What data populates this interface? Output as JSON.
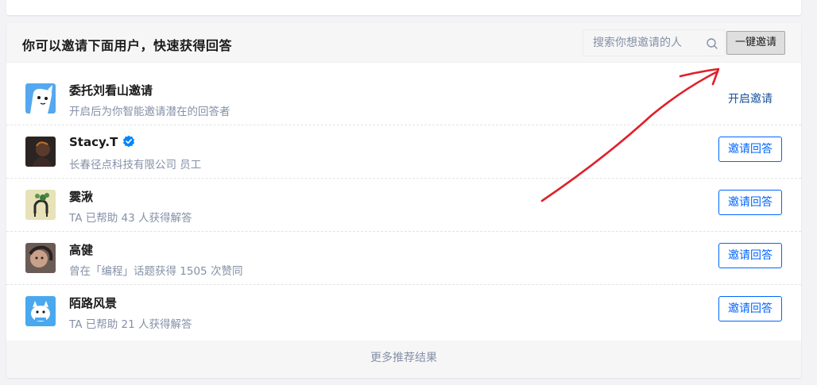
{
  "header": {
    "title": "你可以邀请下面用户，快速获得回答",
    "search_placeholder": "搜索你想邀请的人",
    "invite_all_label": "一键邀请"
  },
  "delegate": {
    "name": "委托刘看山邀请",
    "desc": "开启后为你智能邀请潜在的回答者",
    "action_label": "开启邀请"
  },
  "users": [
    {
      "name": "Stacy.T",
      "desc": "长春径点科技有限公司 员工",
      "verified": true,
      "action_label": "邀请回答"
    },
    {
      "name": "霙湫",
      "desc": "TA 已帮助 43 人获得解答",
      "verified": false,
      "action_label": "邀请回答"
    },
    {
      "name": "高健",
      "desc": "曾在「编程」话题获得 1505 次赞同",
      "verified": false,
      "action_label": "邀请回答"
    },
    {
      "name": "陌路风景",
      "desc": "TA 已帮助 21 人获得解答",
      "verified": false,
      "action_label": "邀请回答"
    }
  ],
  "footer": {
    "more_label": "更多推荐结果"
  },
  "colors": {
    "accent": "#0066ff",
    "link": "#175199",
    "muted": "#8590a6",
    "annotation_arrow": "#e0202a"
  },
  "icons": {
    "search": "search-icon",
    "verified": "verified-badge-icon"
  }
}
